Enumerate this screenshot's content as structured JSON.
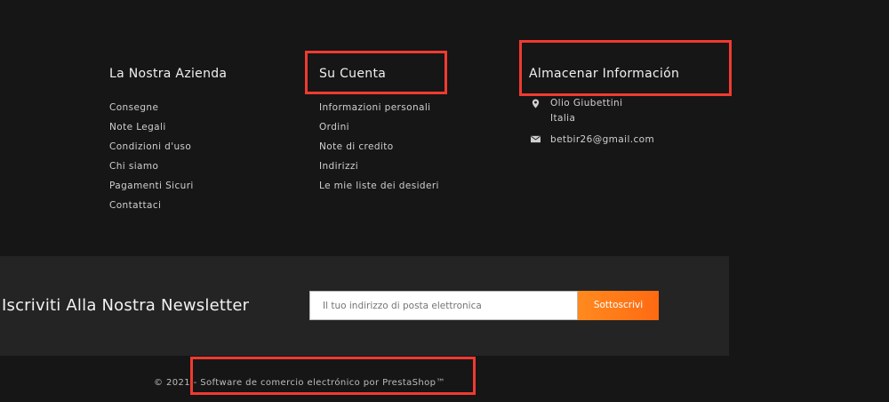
{
  "columns": [
    {
      "title": "La Nostra Azienda",
      "links": [
        "Consegne",
        "Note Legali",
        "Condizioni d'uso",
        "Chi siamo",
        "Pagamenti Sicuri",
        "Contattaci"
      ]
    },
    {
      "title": "Su Cuenta",
      "links": [
        "Informazioni personali",
        "Ordini",
        "Note di credito",
        "Indirizzi",
        "Le mie liste dei desideri"
      ]
    }
  ],
  "store": {
    "title": "Almacenar Información",
    "name": "Olio Giubettini",
    "country": "Italia",
    "email": "betbir26@gmail.com"
  },
  "newsletter": {
    "title": "Iscriviti Alla Nostra Newsletter",
    "placeholder": "Il tuo indirizzo di posta elettronica",
    "button": "Sottoscrivi"
  },
  "footer": {
    "year": "© 2021 -",
    "text": "Software de comercio electrónico por PrestaShop™"
  },
  "colors": {
    "accent": "#ff7a18",
    "highlight": "#f03a30"
  }
}
